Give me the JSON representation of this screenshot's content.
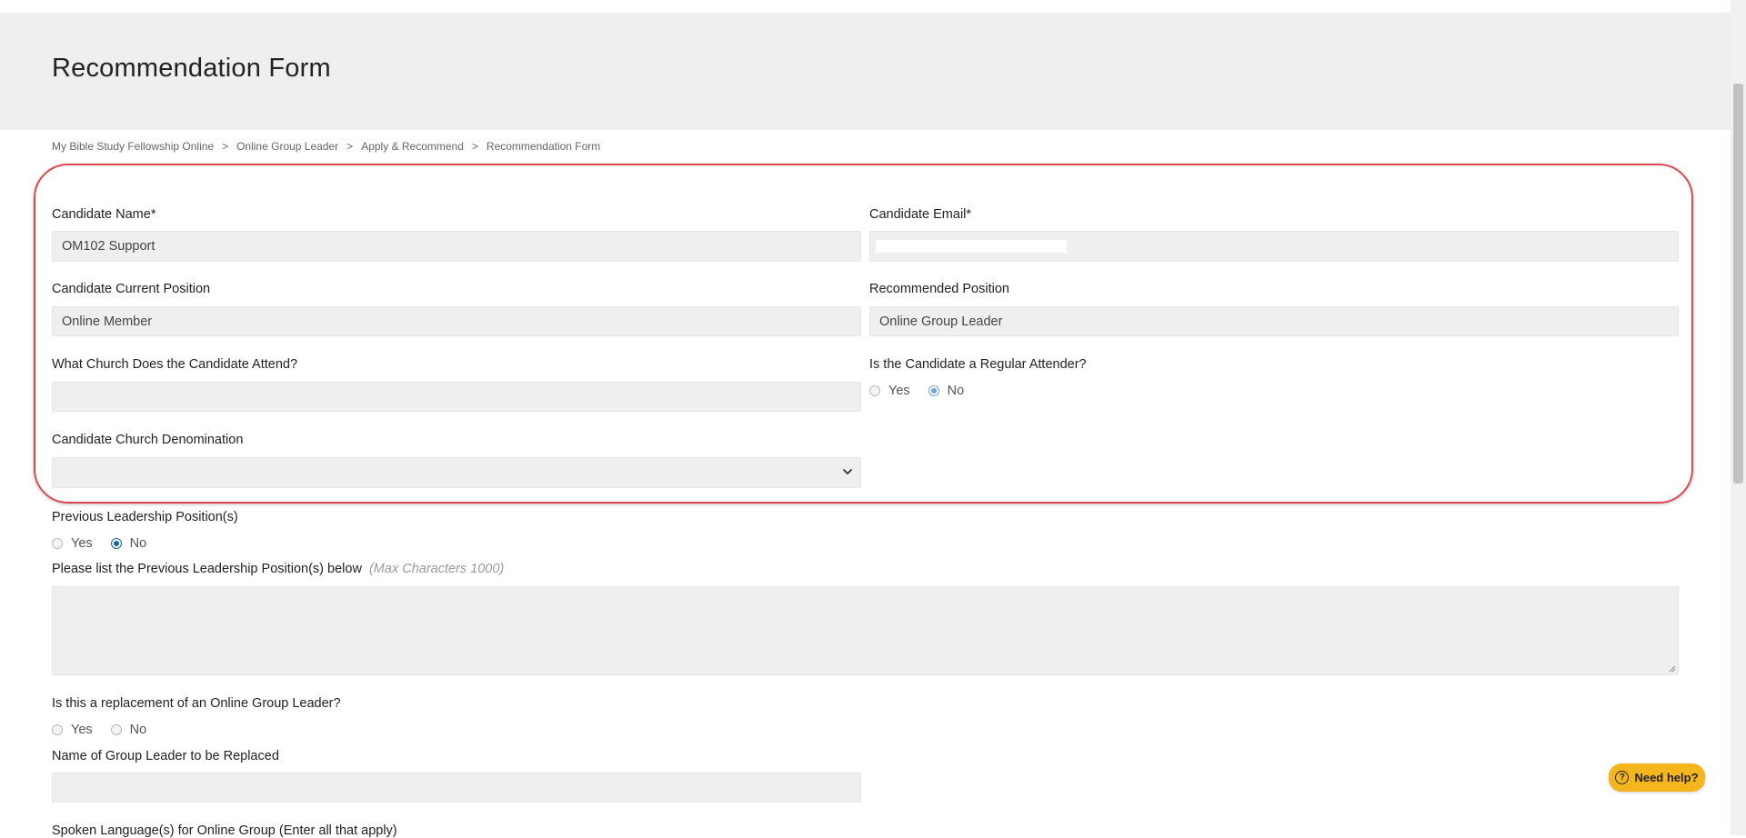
{
  "page": {
    "title": "Recommendation Form"
  },
  "breadcrumb": [
    "My Bible Study Fellowship Online",
    "Online Group Leader",
    "Apply & Recommend",
    "Recommendation Form"
  ],
  "breadcrumb_separator": ">",
  "form": {
    "candidate_name": {
      "label": "Candidate Name*",
      "value": "OM102 Support"
    },
    "candidate_email": {
      "label": "Candidate Email*",
      "value": ""
    },
    "current_position": {
      "label": "Candidate Current Position",
      "value": "Online Member"
    },
    "recommended_position": {
      "label": "Recommended Position",
      "value": "Online Group Leader"
    },
    "church": {
      "label": "What Church Does the Candidate Attend?",
      "value": ""
    },
    "regular_attender": {
      "label": "Is the Candidate a Regular Attender?",
      "options": [
        "Yes",
        "No"
      ],
      "selected": "No"
    },
    "denomination": {
      "label": "Candidate Church Denomination",
      "value": ""
    },
    "previous_leadership": {
      "label": "Previous Leadership Position(s)",
      "options": [
        "Yes",
        "No"
      ],
      "selected": "No"
    },
    "previous_list": {
      "label": "Please list the Previous Leadership Position(s) below",
      "hint": "(Max Characters 1000)",
      "value": ""
    },
    "replacement": {
      "label": "Is this a replacement of an Online Group Leader?",
      "options": [
        "Yes",
        "No"
      ],
      "selected": ""
    },
    "leader_replaced": {
      "label": "Name of Group Leader to be Replaced",
      "value": ""
    },
    "languages": {
      "label": "Spoken Language(s) for Online Group (Enter all that apply)"
    }
  },
  "help": {
    "label": "Need help?",
    "icon": "question-circle-icon",
    "color": "#f5b51c"
  },
  "colors": {
    "highlight_border": "#e0464f",
    "header_bg": "#efefef",
    "field_bg": "#efefef"
  }
}
